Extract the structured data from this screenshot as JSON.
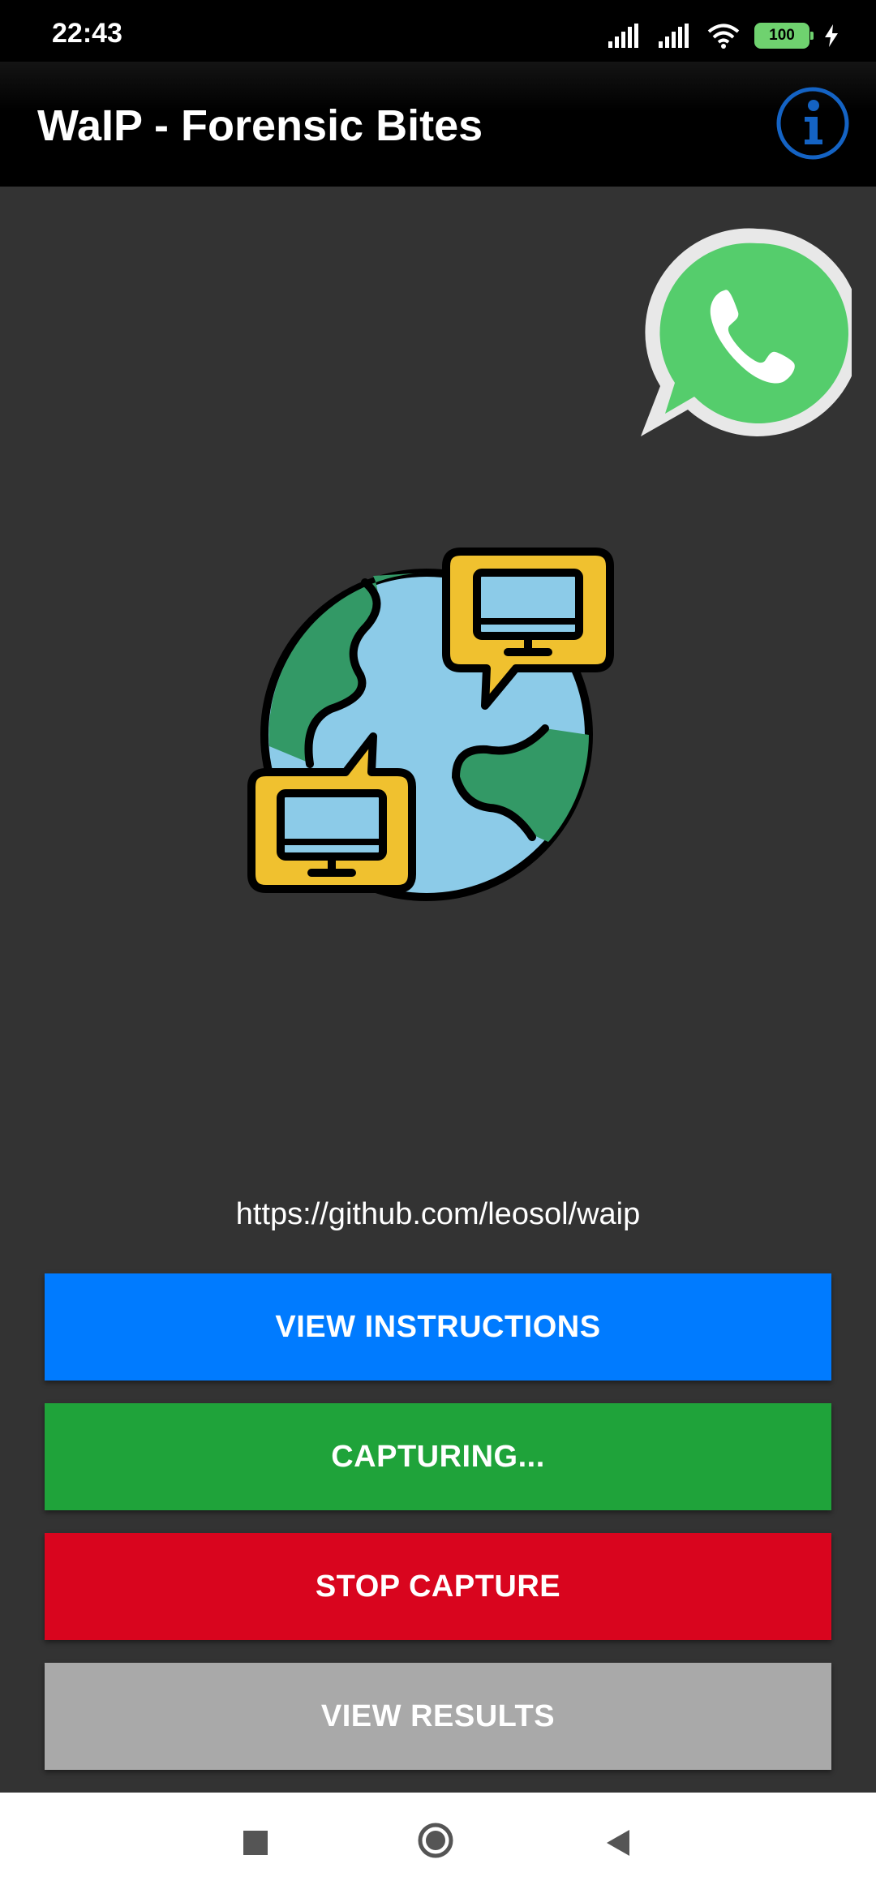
{
  "status_bar": {
    "time": "22:43",
    "battery_level": "100"
  },
  "app_bar": {
    "title": "WaIP - Forensic Bites"
  },
  "main": {
    "repo_url": "https://github.com/leosol/waip"
  },
  "buttons": {
    "view_instructions": "VIEW INSTRUCTIONS",
    "capturing": "CAPTURING...",
    "stop_capture": "STOP CAPTURE",
    "view_results": "VIEW RESULTS"
  },
  "colors": {
    "view_instructions": "#007bff",
    "capturing": "#1fa33a",
    "stop_capture": "#d9051e",
    "view_results": "#a9a9a9",
    "info_icon": "#1463c4",
    "whatsapp": "#55cd6c"
  },
  "icons": [
    "signal-icon",
    "wifi-icon",
    "battery-icon",
    "charging-icon",
    "info-icon",
    "whatsapp-logo-icon",
    "globe-network-icon",
    "recents-icon",
    "home-icon",
    "back-icon"
  ]
}
